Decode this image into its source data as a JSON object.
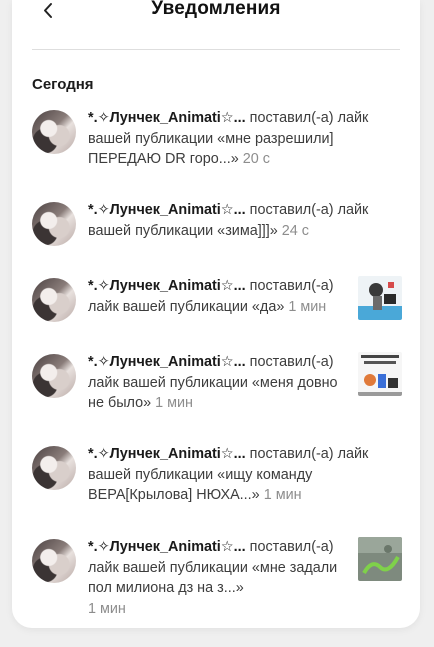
{
  "header": {
    "title": "Уведомления"
  },
  "section": {
    "title": "Сегодня"
  },
  "notifications": [
    {
      "user": "*.✧Лунчек_Animati☆...",
      "action": " поставил(-а) лайк вашей публикации «мне разрешили] ПЕРЕДАЮ DR горо...»",
      "time": "20 с",
      "has_thumbnail": false
    },
    {
      "user": "*.✧Лунчек_Animati☆...",
      "action": " поставил(-а) лайк вашей публикации «зима]]]»",
      "time": "24 с",
      "has_thumbnail": false
    },
    {
      "user": "*.✧Лунчек_Animati☆...",
      "action": " поставил(-а) лайк вашей публикации «да»",
      "time": "1 мин",
      "has_thumbnail": true
    },
    {
      "user": "*.✧Лунчек_Animati☆...",
      "action": " поставил(-а) лайк вашей публикации «меня довно не было»",
      "time": "1 мин",
      "has_thumbnail": true
    },
    {
      "user": "*.✧Лунчек_Animati☆...",
      "action": " поставил(-а) лайк вашей публикации «ищу команду ВЕРА[Крылова] НЮХА...»",
      "time": "1 мин",
      "has_thumbnail": false
    },
    {
      "user": "*.✧Лунчек_Animati☆...",
      "action": " поставил(-а) лайк вашей публикации «мне задали пол милиона дз на з...»",
      "time": "1 мин",
      "has_thumbnail": true
    }
  ],
  "icons": {
    "back": "chevron-left-icon"
  }
}
